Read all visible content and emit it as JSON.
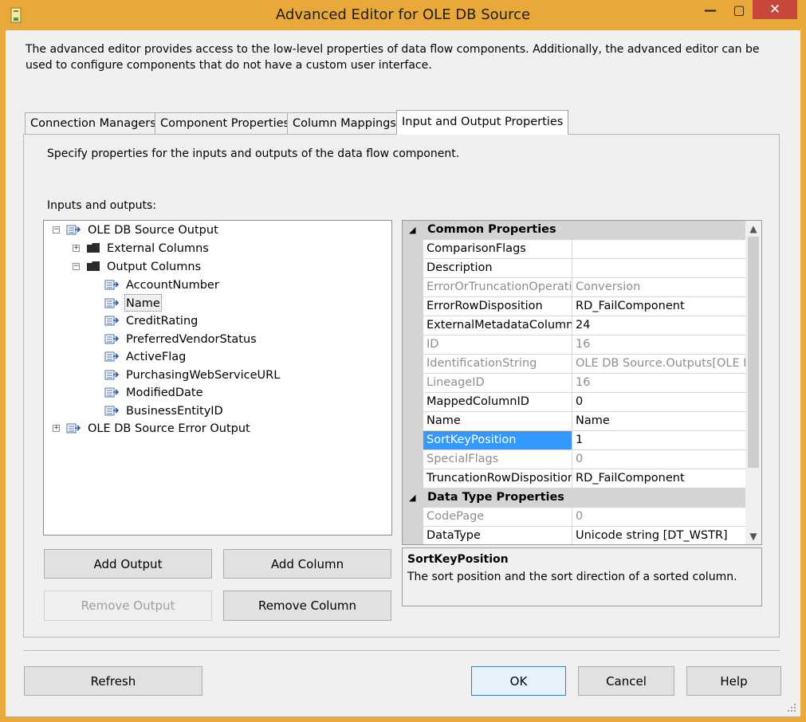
{
  "window": {
    "title": "Advanced Editor for OLE DB Source",
    "controls": {
      "minimize": "—",
      "maximize": "▢",
      "close": "✕"
    },
    "description": "The advanced editor provides access to the low-level properties of data flow components. Additionally, the advanced editor can be used to configure components that do not have a custom user interface."
  },
  "tabs": [
    {
      "label": "Connection Managers"
    },
    {
      "label": "Component Properties"
    },
    {
      "label": "Column Mappings"
    },
    {
      "label": "Input and Output Properties"
    }
  ],
  "panel": {
    "instructions": "Specify properties for the inputs and outputs of the data flow component.",
    "tree_label": "Inputs and outputs:",
    "tree": {
      "root": "OLE DB Source Output",
      "external": "External Columns",
      "output_columns": "Output Columns",
      "columns": [
        "AccountNumber",
        "Name",
        "CreditRating",
        "PreferredVendorStatus",
        "ActiveFlag",
        "PurchasingWebServiceURL",
        "ModifiedDate",
        "BusinessEntityID"
      ],
      "error_output": "OLE DB Source Error Output"
    },
    "buttons": {
      "add_output": "Add Output",
      "add_column": "Add Column",
      "remove_output": "Remove Output",
      "remove_column": "Remove Column"
    },
    "properties": {
      "common_header": "Common Properties",
      "common": [
        {
          "name": "ComparisonFlags",
          "value": ""
        },
        {
          "name": "Description",
          "value": ""
        },
        {
          "name": "ErrorOrTruncationOperation",
          "value": "Conversion"
        },
        {
          "name": "ErrorRowDisposition",
          "value": "RD_FailComponent"
        },
        {
          "name": "ExternalMetadataColumnID",
          "value": "24"
        },
        {
          "name": "ID",
          "value": "16"
        },
        {
          "name": "IdentificationString",
          "value": "OLE DB Source.Outputs[OLE DB"
        },
        {
          "name": "LineageID",
          "value": "16"
        },
        {
          "name": "MappedColumnID",
          "value": "0"
        },
        {
          "name": "Name",
          "value": "Name"
        },
        {
          "name": "SortKeyPosition",
          "value": "1"
        },
        {
          "name": "SpecialFlags",
          "value": "0"
        },
        {
          "name": "TruncationRowDisposition",
          "value": "RD_FailComponent"
        }
      ],
      "datatype_header": "Data Type Properties",
      "datatype": [
        {
          "name": "CodePage",
          "value": "0"
        },
        {
          "name": "DataType",
          "value": "Unicode string [DT_WSTR]"
        }
      ],
      "scroll_up": "▲",
      "scroll_down": "▼",
      "collapse_glyph": "◢"
    },
    "help": {
      "title": "SortKeyPosition",
      "text": "The sort position and the sort direction of a sorted column."
    }
  },
  "footer": {
    "refresh": "Refresh",
    "ok": "OK",
    "cancel": "Cancel",
    "help": "Help"
  },
  "colors": {
    "title_bar": "#e8a93a",
    "close_button": "#c7473b",
    "selection": "#3399ff"
  }
}
